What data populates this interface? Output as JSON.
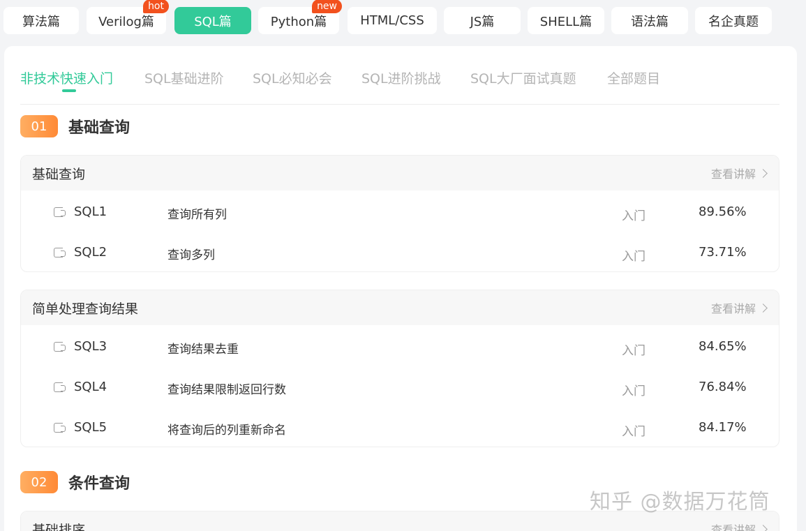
{
  "categories": [
    {
      "label": "算法篇"
    },
    {
      "label": "Verilog篇",
      "badge": "hot"
    },
    {
      "label": "SQL篇",
      "active": true
    },
    {
      "label": "Python篇",
      "badge": "new"
    },
    {
      "label": "HTML/CSS"
    },
    {
      "label": "JS篇"
    },
    {
      "label": "SHELL篇"
    },
    {
      "label": "语法篇"
    },
    {
      "label": "名企真题"
    }
  ],
  "subtabs": [
    "非技术快速入门",
    "SQL基础进阶",
    "SQL必知必会",
    "SQL进阶挑战",
    "SQL大厂面试真题",
    "全部题目"
  ],
  "colors": {
    "accent": "#32ca99",
    "badge": "#f2511e",
    "section_num": "#ff8a36"
  },
  "sections": [
    {
      "num": "01",
      "title": "基础查询",
      "groups": [
        {
          "title": "基础查询",
          "link": "查看讲解",
          "rows": [
            {
              "id": "SQL1",
              "name": "查询所有列",
              "level": "入门",
              "rate": "89.56%"
            },
            {
              "id": "SQL2",
              "name": "查询多列",
              "level": "入门",
              "rate": "73.71%"
            }
          ]
        },
        {
          "title": "简单处理查询结果",
          "link": "查看讲解",
          "rows": [
            {
              "id": "SQL3",
              "name": "查询结果去重",
              "level": "入门",
              "rate": "84.65%"
            },
            {
              "id": "SQL4",
              "name": "查询结果限制返回行数",
              "level": "入门",
              "rate": "76.84%"
            },
            {
              "id": "SQL5",
              "name": "将查询后的列重新命名",
              "level": "入门",
              "rate": "84.17%"
            }
          ]
        }
      ]
    },
    {
      "num": "02",
      "title": "条件查询",
      "groups": [
        {
          "title": "基础排序",
          "link": "查看讲解",
          "rows": []
        }
      ]
    }
  ],
  "watermark": "知乎 @数据万花筒"
}
